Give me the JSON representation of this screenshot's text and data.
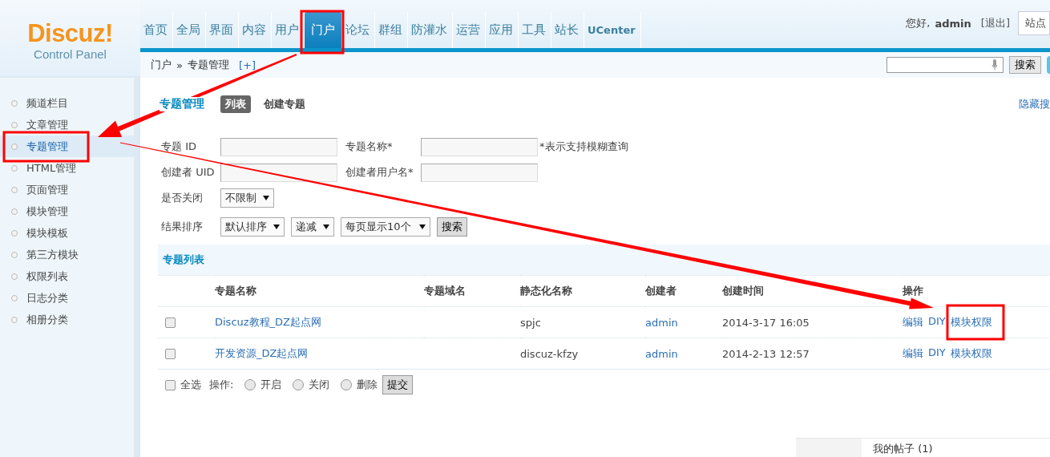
{
  "header": {
    "logo_title": "Discuz!",
    "logo_subtitle": "Control Panel",
    "nav": [
      {
        "label": "首页",
        "selected": false
      },
      {
        "label": "全局",
        "selected": false
      },
      {
        "label": "界面",
        "selected": false
      },
      {
        "label": "内容",
        "selected": false
      },
      {
        "label": "用户",
        "selected": false
      },
      {
        "label": "门户",
        "selected": true
      },
      {
        "label": "论坛",
        "selected": false
      },
      {
        "label": "群组",
        "selected": false
      },
      {
        "label": "防灌水",
        "selected": false
      },
      {
        "label": "运营",
        "selected": false
      },
      {
        "label": "应用",
        "selected": false
      },
      {
        "label": "工具",
        "selected": false
      },
      {
        "label": "站长",
        "selected": false
      },
      {
        "label": "UCenter",
        "selected": false
      }
    ],
    "greeting": "您好,",
    "user": "admin",
    "logout": "[退出]",
    "site_button": "站点"
  },
  "breadcrumb": {
    "items": [
      "门户",
      "专题管理"
    ],
    "separator": "»",
    "add": "[+]"
  },
  "top_search": {
    "button": "搜索"
  },
  "sidebar": [
    {
      "label": "频道栏目",
      "selected": false
    },
    {
      "label": "文章管理",
      "selected": false
    },
    {
      "label": "专题管理",
      "selected": true
    },
    {
      "label": "HTML管理",
      "selected": false
    },
    {
      "label": "页面管理",
      "selected": false
    },
    {
      "label": "模块管理",
      "selected": false
    },
    {
      "label": "模块模板",
      "selected": false
    },
    {
      "label": "第三方模块",
      "selected": false
    },
    {
      "label": "权限列表",
      "selected": false
    },
    {
      "label": "日志分类",
      "selected": false
    },
    {
      "label": "相册分类",
      "selected": false
    }
  ],
  "content": {
    "title": "专题管理",
    "tabs": [
      {
        "label": "列表",
        "selected": true
      },
      {
        "label": "创建专题",
        "selected": false
      }
    ],
    "toggle_link": "隐藏搜",
    "search_form": [
      [
        {
          "kind": "label",
          "text": "专题 ID"
        },
        {
          "kind": "input"
        },
        {
          "kind": "label",
          "text": "专题名称*"
        },
        {
          "kind": "input"
        },
        {
          "kind": "note",
          "text": "*表示支持模糊查询"
        }
      ],
      [
        {
          "kind": "label",
          "text": "创建者 UID"
        },
        {
          "kind": "input"
        },
        {
          "kind": "label",
          "text": "创建者用户名*"
        },
        {
          "kind": "input"
        }
      ],
      [
        {
          "kind": "label",
          "text": "是否关闭"
        },
        {
          "kind": "select",
          "value": "不限制"
        }
      ],
      [
        {
          "kind": "label",
          "text": "结果排序"
        },
        {
          "kind": "select",
          "value": "默认排序"
        },
        {
          "kind": "select",
          "value": "递减"
        },
        {
          "kind": "select",
          "value": "每页显示10个"
        },
        {
          "kind": "button",
          "text": "搜索"
        }
      ]
    ],
    "list_title": "专题列表",
    "columns": [
      "专题名称",
      "专题域名",
      "静态化名称",
      "创建者",
      "创建时间",
      "操作"
    ],
    "rows": [
      {
        "checked": false,
        "name": "Discuz教程_DZ起点网",
        "static_name": "spjc",
        "creator": "admin",
        "created": "2014-3-17 16:05",
        "actions": [
          "编辑",
          "DIY",
          "模块权限"
        ]
      },
      {
        "checked": false,
        "name": "开发资源_DZ起点网",
        "static_name": "discuz-kfzy",
        "creator": "admin",
        "created": "2014-2-13 12:57",
        "actions": [
          "编辑",
          "DIY",
          "模块权限"
        ]
      }
    ],
    "footer": {
      "select_all": {
        "label": "全选",
        "checked": false
      },
      "ops_label": "操作:",
      "options": [
        {
          "label": "开启",
          "selected": false
        },
        {
          "label": "关闭",
          "selected": false
        },
        {
          "label": "删除",
          "selected": false
        }
      ],
      "submit": "提交"
    }
  },
  "popup": {
    "text": "我的帖子 (1)"
  }
}
